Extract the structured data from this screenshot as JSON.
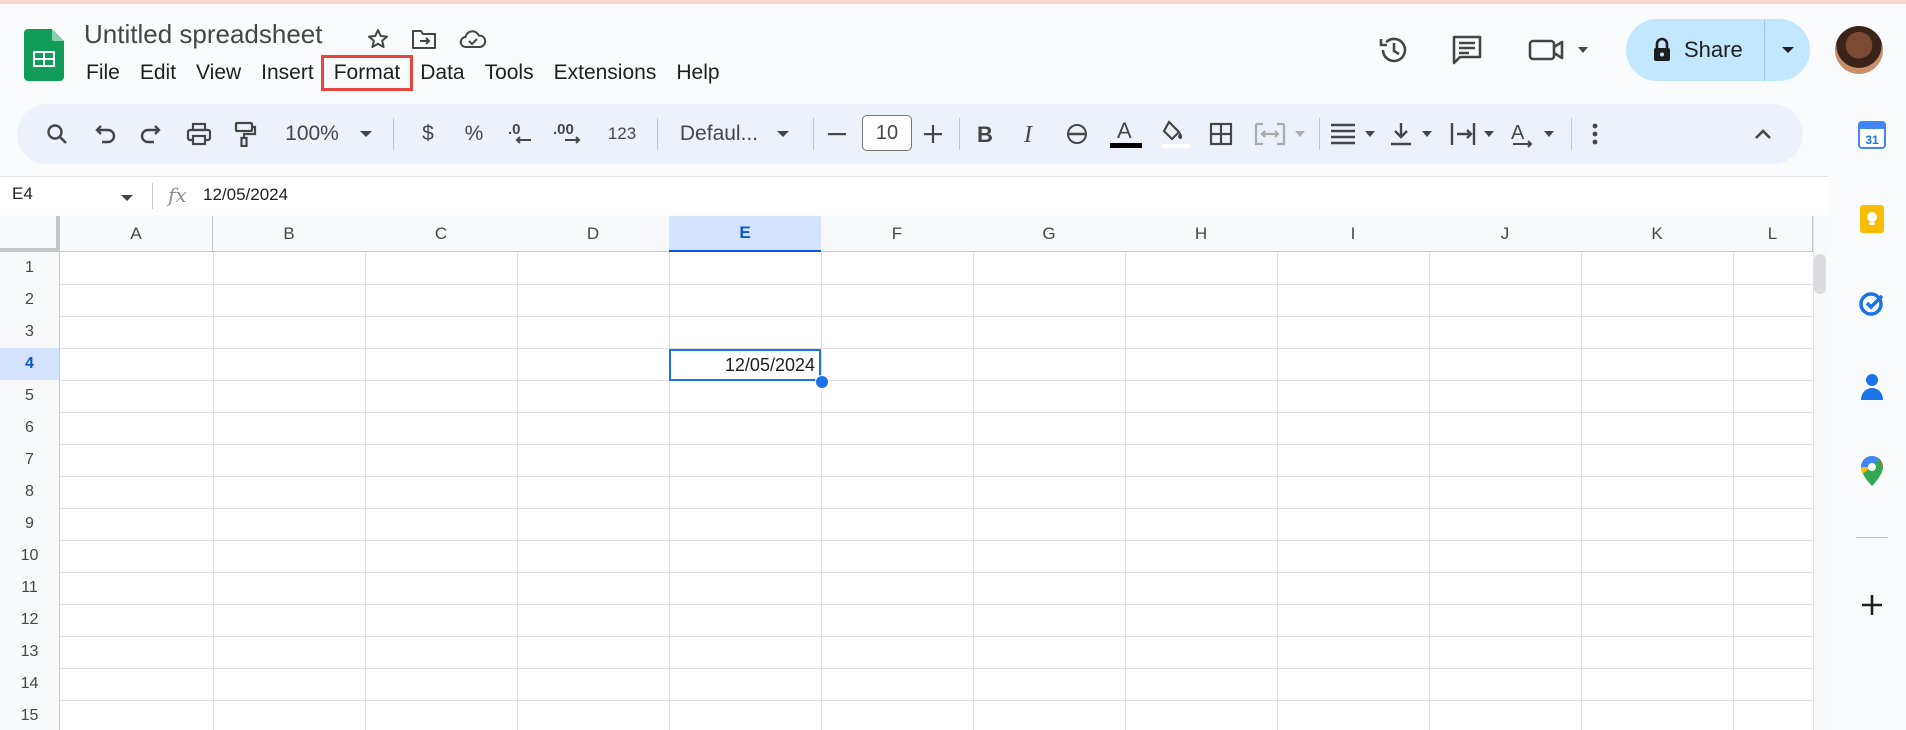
{
  "doc": {
    "title": "Untitled spreadsheet"
  },
  "menu": [
    "File",
    "Edit",
    "View",
    "Insert",
    "Format",
    "Data",
    "Tools",
    "Extensions",
    "Help"
  ],
  "menu_highlighted": "Format",
  "share": {
    "label": "Share"
  },
  "toolbar": {
    "zoom": "100%",
    "currency": "$",
    "percent": "%",
    "decrease_decimal": ".0",
    "increase_decimal": ".00",
    "number_format": "123",
    "font": "Defaul...",
    "font_size": "10"
  },
  "formula_bar": {
    "name_box": "E4",
    "fx": "fx",
    "value": "12/05/2024"
  },
  "grid": {
    "columns": [
      "A",
      "B",
      "C",
      "D",
      "E",
      "F",
      "G",
      "H",
      "I",
      "J",
      "K",
      "L"
    ],
    "rows": [
      "1",
      "2",
      "3",
      "4",
      "5",
      "6",
      "7",
      "8",
      "9",
      "10",
      "11",
      "12",
      "13",
      "14",
      "15"
    ],
    "selected_cell": {
      "ref": "E4",
      "value": "12/05/2024"
    }
  },
  "calendar_day": "31",
  "colors": {
    "accent": "#0b57d0",
    "share_bg": "#c2e7ff",
    "highlight": "#e8453c",
    "sheets_green": "#0f9d58"
  }
}
